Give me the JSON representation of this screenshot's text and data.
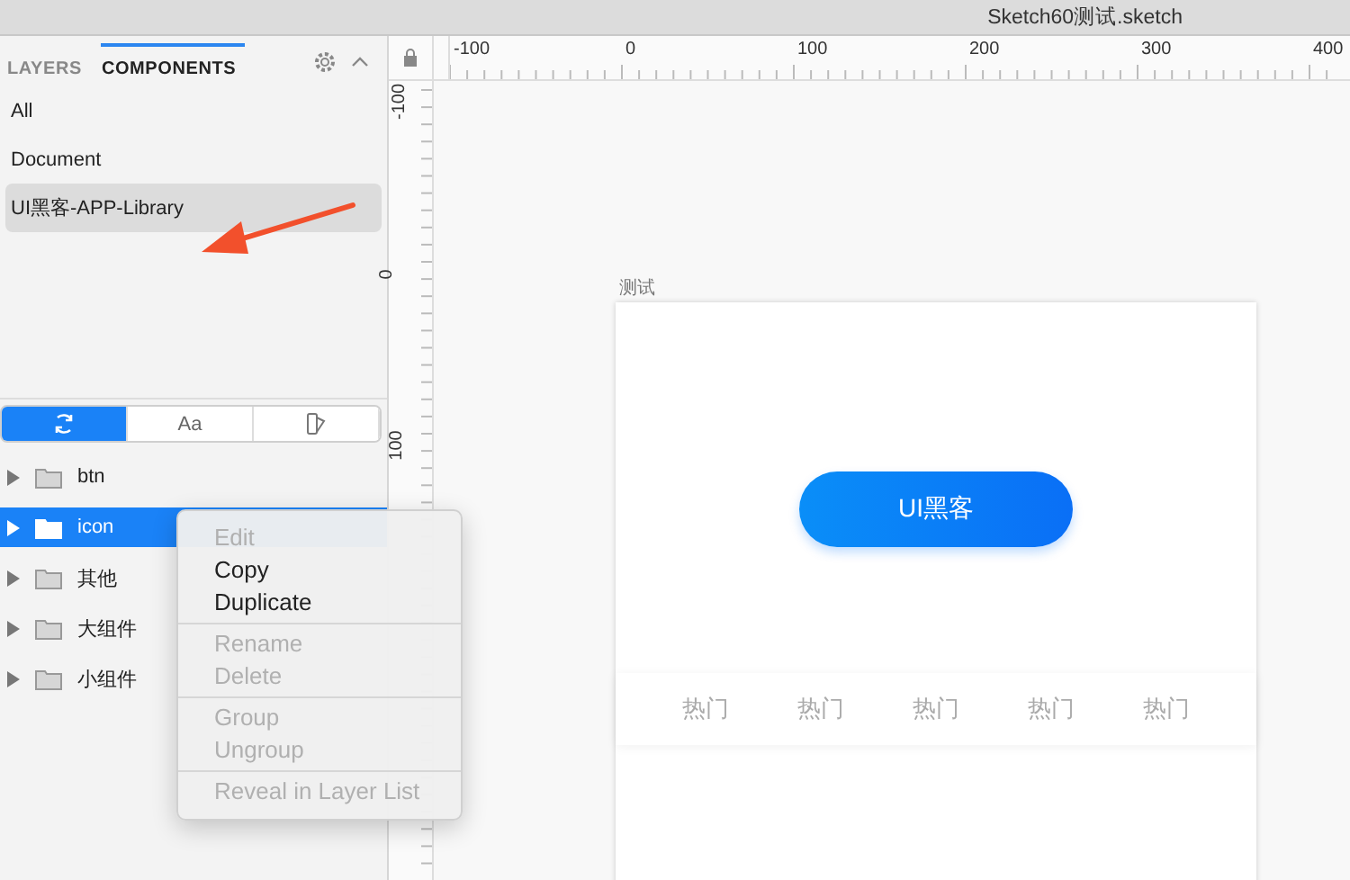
{
  "window": {
    "title": "Sketch60测试.sketch"
  },
  "sidebar": {
    "tabs": [
      {
        "label": "LAYERS",
        "selected": false
      },
      {
        "label": "COMPONENTS",
        "selected": true
      }
    ],
    "libraries": [
      {
        "label": "All",
        "selected": false
      },
      {
        "label": "Document",
        "selected": false
      },
      {
        "label": "UI黑客-APP-Library",
        "selected": true
      }
    ],
    "segments": [
      {
        "kind": "symbols",
        "selected": true
      },
      {
        "kind": "text",
        "label": "Aa",
        "selected": false
      },
      {
        "kind": "styles",
        "selected": false
      }
    ],
    "tree": [
      {
        "label": "btn",
        "selected": false
      },
      {
        "label": "icon",
        "selected": true
      },
      {
        "label": "其他",
        "selected": false
      },
      {
        "label": "大组件",
        "selected": false
      },
      {
        "label": "小组件",
        "selected": false
      }
    ]
  },
  "context_menu": {
    "groups": [
      [
        {
          "label": "Edit",
          "disabled": true
        },
        {
          "label": "Copy",
          "disabled": false
        },
        {
          "label": "Duplicate",
          "disabled": false
        }
      ],
      [
        {
          "label": "Rename",
          "disabled": true
        },
        {
          "label": "Delete",
          "disabled": true
        }
      ],
      [
        {
          "label": "Group",
          "disabled": true
        },
        {
          "label": "Ungroup",
          "disabled": true
        }
      ],
      [
        {
          "label": "Reveal in Layer List",
          "disabled": true
        }
      ]
    ]
  },
  "rulers": {
    "horizontal": [
      "-100",
      "0",
      "100",
      "200",
      "300",
      "400"
    ],
    "vertical": [
      "-100",
      "0",
      "100"
    ]
  },
  "artboard": {
    "title": "测试",
    "button": "UI黑客",
    "tabs": [
      "热门",
      "热门",
      "热门",
      "热门",
      "热门"
    ]
  }
}
